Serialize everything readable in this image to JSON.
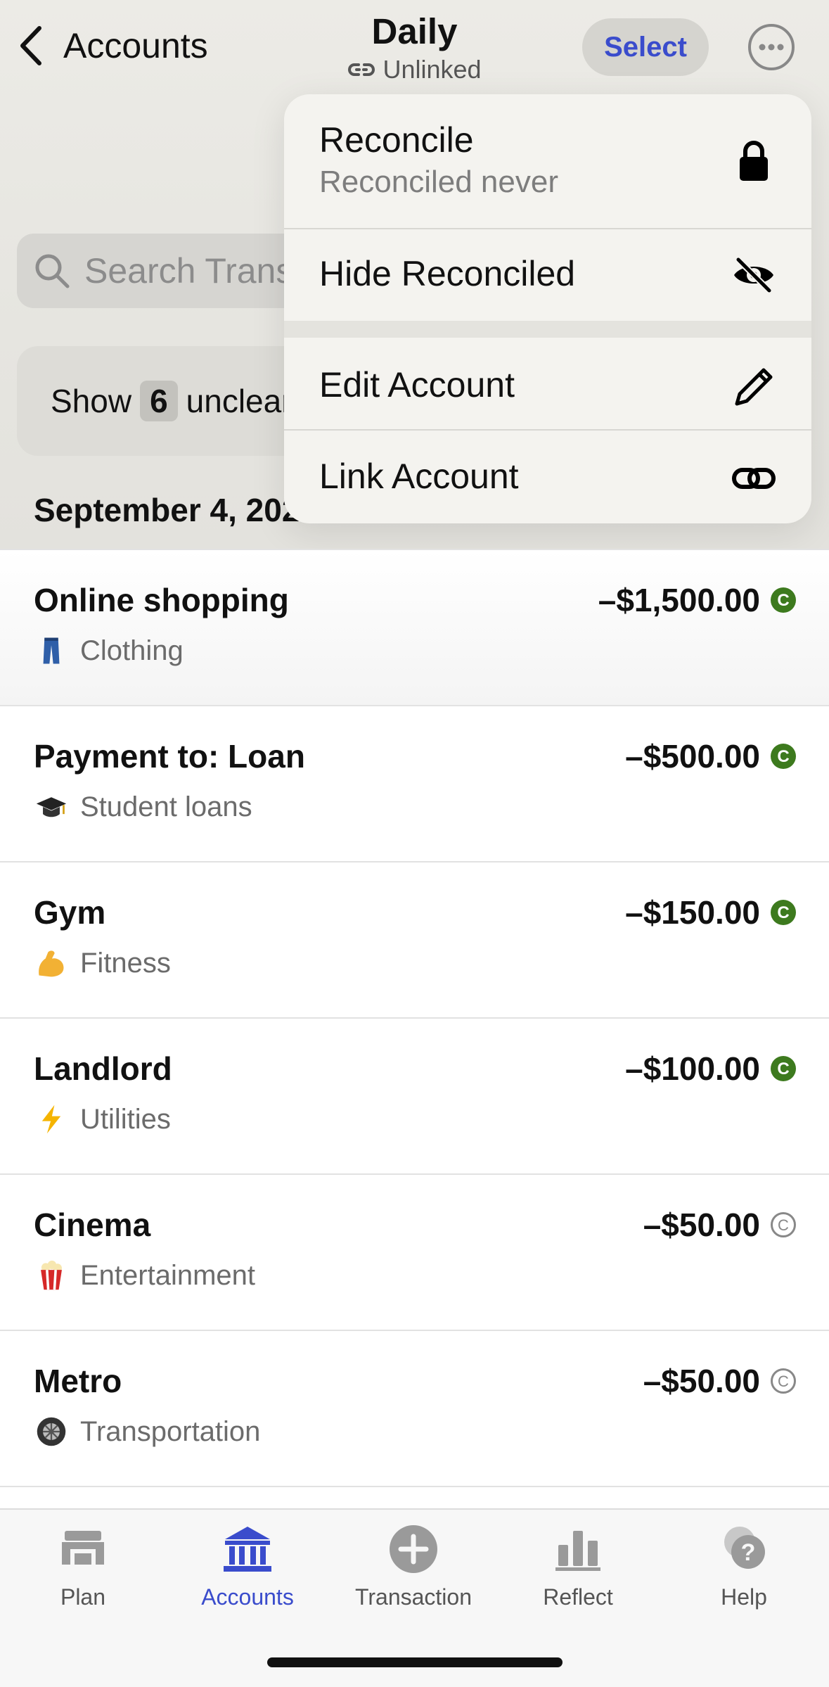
{
  "nav": {
    "back_label": "Accounts",
    "title": "Daily",
    "subtitle": "Unlinked",
    "select_label": "Select"
  },
  "search": {
    "placeholder": "Search Trans"
  },
  "unclear_banner": {
    "prefix": "Show",
    "count": "6",
    "suffix": "unclear"
  },
  "date_header": "September 4, 2025",
  "menu": {
    "reconcile_label": "Reconcile",
    "reconcile_sub": "Reconciled never",
    "hide_label": "Hide Reconciled",
    "edit_label": "Edit Account",
    "link_label": "Link Account"
  },
  "transactions": [
    {
      "name": "Online shopping",
      "category": "Clothing",
      "amount": "–$1,500.00",
      "cleared": true,
      "emoji": "jeans"
    },
    {
      "name": "Payment to: Loan",
      "category": "Student loans",
      "amount": "–$500.00",
      "cleared": true,
      "emoji": "grad-cap"
    },
    {
      "name": "Gym",
      "category": "Fitness",
      "amount": "–$150.00",
      "cleared": true,
      "emoji": "flexed-biceps"
    },
    {
      "name": "Landlord",
      "category": "Utilities",
      "amount": "–$100.00",
      "cleared": true,
      "emoji": "lightning"
    },
    {
      "name": "Cinema",
      "category": "Entertainment",
      "amount": "–$50.00",
      "cleared": false,
      "emoji": "popcorn"
    },
    {
      "name": "Metro",
      "category": "Transportation",
      "amount": "–$50.00",
      "cleared": false,
      "emoji": "wheel"
    }
  ],
  "tabs": [
    {
      "label": "Plan",
      "icon": "plan-icon"
    },
    {
      "label": "Accounts",
      "icon": "bank-icon",
      "active": true
    },
    {
      "label": "Transaction",
      "icon": "add-circle-icon"
    },
    {
      "label": "Reflect",
      "icon": "bar-chart-icon"
    },
    {
      "label": "Help",
      "icon": "help-icon"
    }
  ],
  "colors": {
    "accent": "#3a4ccc",
    "cleared_green": "#3d7a1e"
  }
}
